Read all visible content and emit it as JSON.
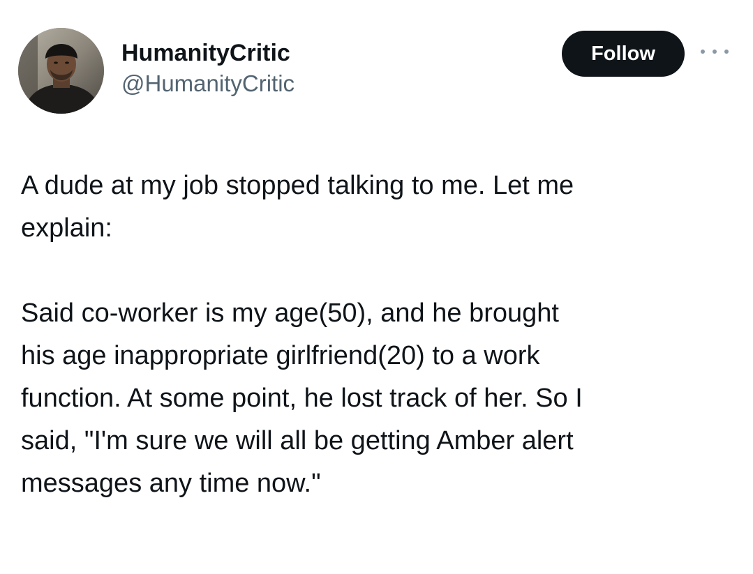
{
  "author": {
    "display_name": "HumanityCritic",
    "handle": "@HumanityCritic",
    "avatar": "profile-photo"
  },
  "actions": {
    "follow_label": "Follow",
    "more_icon": "more-options-icon"
  },
  "tweet": {
    "paragraphs": [
      "A dude at my job stopped talking to me. Let me\nexplain:",
      "Said co-worker is my age(50), and he brought\nhis age inappropriate girlfriend(20) to a work\nfunction. At some point, he lost track of her. So I\nsaid, \"I'm sure we will all be getting Amber alert\nmessages any time now.\""
    ]
  },
  "colors": {
    "text": "#0f1419",
    "secondary_text": "#536471",
    "follow_bg": "#0f1419",
    "follow_text": "#ffffff"
  }
}
